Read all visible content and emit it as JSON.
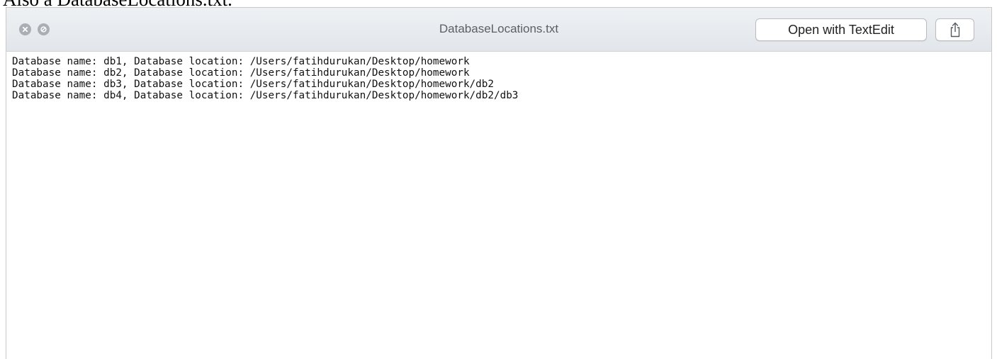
{
  "caption": "Also a DatabaseLocations.txt.",
  "window": {
    "title": "DatabaseLocations.txt",
    "open_button_label": "Open with TextEdit",
    "icons": {
      "close": "close-icon",
      "minimize": "minimize-icon",
      "share": "share-icon"
    }
  },
  "file": {
    "lines": [
      "Database name: db1, Database location: /Users/fatihdurukan/Desktop/homework",
      "Database name: db2, Database location: /Users/fatihdurukan/Desktop/homework",
      "Database name: db3, Database location: /Users/fatihdurukan/Desktop/homework/db2",
      "Database name: db4, Database location: /Users/fatihdurukan/Desktop/homework/db2/db3"
    ]
  },
  "colors": {
    "titlebar": "#e7eaed",
    "traffic_inactive": "#a9afb5",
    "title_text": "#5b6068"
  }
}
